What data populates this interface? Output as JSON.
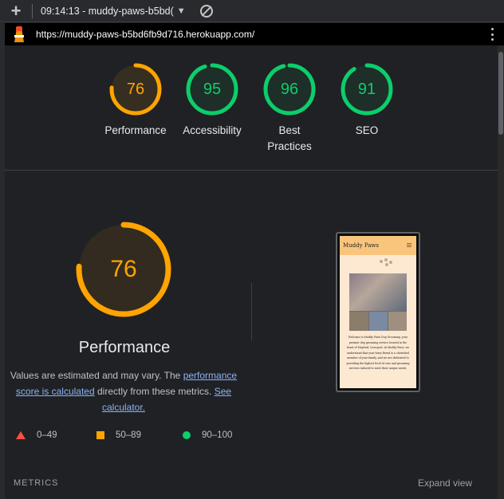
{
  "tab": {
    "title": "09:14:13 - muddy-paws-b5bd("
  },
  "url_bar": {
    "url": "https://muddy-paws-b5bd6fb9d716.herokuapp.com/"
  },
  "colors": {
    "pass": "#0cce6b",
    "average": "#ffa400",
    "fail": "#ff4e42",
    "link": "#8ab4f8"
  },
  "scores": [
    {
      "value": "76",
      "label": "Performance",
      "score": 76
    },
    {
      "value": "95",
      "label": "Accessibility",
      "score": 95
    },
    {
      "value": "96",
      "label": "Best Practices",
      "score": 96
    },
    {
      "value": "91",
      "label": "SEO",
      "score": 91
    }
  ],
  "performance": {
    "score": "76",
    "title": "Performance",
    "desc_1": "Values are estimated and may vary. The",
    "link_1": "performance score is calculated",
    "desc_2": "directly from these metrics.",
    "link_2": "See calculator."
  },
  "legend": [
    {
      "label": "0–49",
      "icon": "triangle"
    },
    {
      "label": "50–89",
      "icon": "square"
    },
    {
      "label": "90–100",
      "icon": "circle"
    }
  ],
  "screenshot": {
    "site_title": "Muddy Paws",
    "body_text": "Welcome to Muddy Paws Dog Grooming, your premier dog grooming service located in the heart of Mayford, Liverpool. At Muddy Paws, we understand that your furry friend is a cherished member of your family, and we are dedicated to providing the highest level of care and grooming services tailored to meet their unique needs."
  },
  "footer": {
    "metrics_label": "METRICS",
    "expand_label": "Expand view"
  }
}
